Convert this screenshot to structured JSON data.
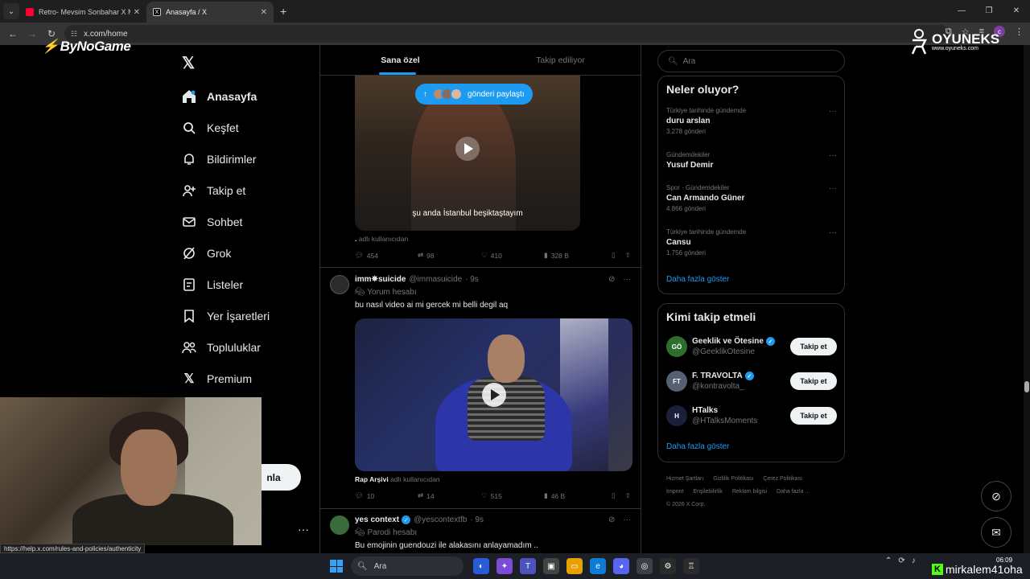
{
  "browser": {
    "tabs": [
      {
        "title": "Retro- Mevsim Sonbahar X MV",
        "active": false
      },
      {
        "title": "Anasayfa / X",
        "active": true
      }
    ],
    "url": "x.com/home",
    "status_url": "https://help.x.com/rules-and-policies/authenticity",
    "profile_initial": "c"
  },
  "watermarks": {
    "left": "ByNoGame",
    "right_name": "OYUNEKS",
    "right_url": "www.oyuneks.com",
    "bottom": "mirkalem41oha"
  },
  "sidebar": {
    "items": [
      {
        "label": "Anasayfa",
        "icon": "home-icon"
      },
      {
        "label": "Keşfet",
        "icon": "search-icon"
      },
      {
        "label": "Bildirimler",
        "icon": "bell-icon"
      },
      {
        "label": "Takip et",
        "icon": "person-add-icon"
      },
      {
        "label": "Sohbet",
        "icon": "mail-icon"
      },
      {
        "label": "Grok",
        "icon": "grok-icon"
      },
      {
        "label": "Listeler",
        "icon": "list-icon"
      },
      {
        "label": "Yer İşaretleri",
        "icon": "bookmark-icon"
      },
      {
        "label": "Topluluklar",
        "icon": "people-icon"
      },
      {
        "label": "Premium",
        "icon": "x-logo-icon"
      }
    ],
    "post_button_partial": "nla"
  },
  "feed": {
    "tabs": [
      "Sana özel",
      "Takip ediliyor"
    ],
    "share_pill": "gönderi paylaştı",
    "tweets": [
      {
        "video_caption": "şu anda İstanbul beşiktaştayım",
        "attribution_name": ".",
        "attribution_suffix": "adlı kullanıcıdan",
        "replies": "454",
        "reposts": "98",
        "likes": "410",
        "views": "328 B"
      },
      {
        "name": "imm✵suicide",
        "handle": "@immasuicide",
        "time": "· 9s",
        "label": "Yorum hesabı",
        "text": "bu nasıl video ai mi gercek mi belli degil aq",
        "attribution_name": "Rap Arşivi",
        "attribution_suffix": "adlı kullanıcıdan",
        "replies": "10",
        "reposts": "14",
        "likes": "515",
        "views": "46 B"
      },
      {
        "name": "yes context",
        "handle": "@yescontextfb",
        "time": "· 9s",
        "label": "Parodi hesabı",
        "text": "Bu emojinin guendouzi ile alakasını anlayamadım .."
      }
    ]
  },
  "right": {
    "search_placeholder": "Ara",
    "trends_title": "Neler oluyor?",
    "trends": [
      {
        "context": "Türkiye tarihinde gündemde",
        "name": "duru arslan",
        "posts": "3.278 gönderi"
      },
      {
        "context": "Gündemdekiler",
        "name": "Yusuf Demir",
        "posts": ""
      },
      {
        "context": "Spor · Gündemdekiler",
        "name": "Can Armando Güner",
        "posts": "4.866 gönderi"
      },
      {
        "context": "Türkiye tarihinde gündemde",
        "name": "Cansu",
        "posts": "1.756 gönderi"
      }
    ],
    "show_more": "Daha fazla göster",
    "who_title": "Kimi takip etmeli",
    "who": [
      {
        "name": "Geeklik ve Ötesine",
        "handle": "@GeeklikOtesine",
        "button": "Takip et",
        "verified": true
      },
      {
        "name": "F. TRAVOLTA",
        "handle": "@kontravolta_",
        "button": "Takip et",
        "verified": true
      },
      {
        "name": "HTalks",
        "handle": "@HTalksMoments",
        "button": "Takip et",
        "verified": false
      }
    ],
    "who_more": "Daha fazla göster",
    "footer": [
      "Hizmet Şartları",
      "Gizlilik Politikası",
      "Çerez Politikası",
      "İmprint",
      "Erişilebilirlik",
      "Reklam bilgisi",
      "Daha fazla ...",
      "© 2026 X Corp."
    ]
  },
  "taskbar": {
    "search": "Ara",
    "time": "06:09"
  }
}
